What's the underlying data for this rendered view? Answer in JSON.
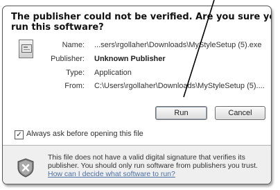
{
  "dialog": {
    "heading_line1": "The publisher could not be verified.  Are you sure you want to",
    "heading_line2": "run this software?"
  },
  "details": {
    "name_label": "Name:",
    "name_value": "...sers\\rgollaher\\Downloads\\MyStyleSetup (5).exe",
    "publisher_label": "Publisher:",
    "publisher_value": "Unknown Publisher",
    "type_label": "Type:",
    "type_value": "Application",
    "from_label": "From:",
    "from_value": "C:\\Users\\rgollaher\\Downloads\\MyStyleSetup (5)...."
  },
  "buttons": {
    "run": "Run",
    "cancel": "Cancel"
  },
  "options": {
    "always_ask_label": "Always ask before opening this file",
    "always_ask_checked": true
  },
  "footer": {
    "warning_line1": "This file does not have a valid digital signature that verifies its",
    "warning_line2": "publisher.  You should only run software from publishers you trust.",
    "help_link": "How can I decide what software to run?"
  },
  "colors": {
    "link": "#4a6fa5",
    "footer_bg": "#efefef",
    "pointer_line": "#000000"
  },
  "icons": {
    "file": "application-file-icon",
    "shield": "security-shield-icon",
    "check": "checkmark"
  }
}
